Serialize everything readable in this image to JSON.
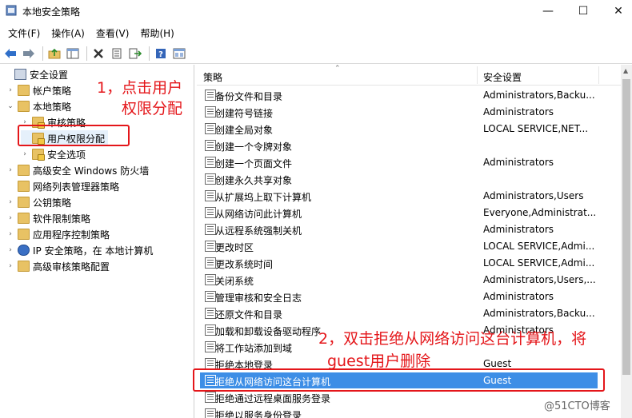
{
  "window": {
    "title": "本地安全策略",
    "minimize": "—",
    "maximize": "☐",
    "close": "✕"
  },
  "menu": [
    "文件(F)",
    "操作(A)",
    "查看(V)",
    "帮助(H)"
  ],
  "toolbar": [
    "back-arrow-icon",
    "forward-arrow-icon",
    "up-folder-icon",
    "show-tree-icon",
    "delete-icon",
    "properties-icon",
    "export-icon",
    "help-icon",
    "view-icon"
  ],
  "tree": [
    {
      "label": "安全设置",
      "twisty": "",
      "indent": 0
    },
    {
      "label": "帐户策略",
      "twisty": "›",
      "indent": 1
    },
    {
      "label": "本地策略",
      "twisty": "⌄",
      "indent": 1
    },
    {
      "label": "审核策略",
      "twisty": "›",
      "indent": 2
    },
    {
      "label": "用户权限分配",
      "twisty": "",
      "indent": 2
    },
    {
      "label": "安全选项",
      "twisty": "›",
      "indent": 2
    },
    {
      "label": "高级安全 Windows 防火墙",
      "twisty": "›",
      "indent": 1
    },
    {
      "label": "网络列表管理器策略",
      "twisty": "",
      "indent": 1
    },
    {
      "label": "公钥策略",
      "twisty": "›",
      "indent": 1
    },
    {
      "label": "软件限制策略",
      "twisty": "›",
      "indent": 1
    },
    {
      "label": "应用程序控制策略",
      "twisty": "›",
      "indent": 1
    },
    {
      "label": "IP 安全策略，在 本地计算机",
      "twisty": "›",
      "indent": 1
    },
    {
      "label": "高级审核策略配置",
      "twisty": "›",
      "indent": 1
    }
  ],
  "list": {
    "columns": [
      "策略",
      "安全设置"
    ],
    "rows": [
      {
        "policy": "备份文件和目录",
        "setting": "Administrators,Backu..."
      },
      {
        "policy": "创建符号链接",
        "setting": "Administrators"
      },
      {
        "policy": "创建全局对象",
        "setting": "LOCAL SERVICE,NET..."
      },
      {
        "policy": "创建一个令牌对象",
        "setting": ""
      },
      {
        "policy": "创建一个页面文件",
        "setting": "Administrators"
      },
      {
        "policy": "创建永久共享对象",
        "setting": ""
      },
      {
        "policy": "从扩展坞上取下计算机",
        "setting": "Administrators,Users"
      },
      {
        "policy": "从网络访问此计算机",
        "setting": "Everyone,Administrat..."
      },
      {
        "policy": "从远程系统强制关机",
        "setting": "Administrators"
      },
      {
        "policy": "更改时区",
        "setting": "LOCAL SERVICE,Admi..."
      },
      {
        "policy": "更改系统时间",
        "setting": "LOCAL SERVICE,Admi..."
      },
      {
        "policy": "关闭系统",
        "setting": "Administrators,Users,..."
      },
      {
        "policy": "管理审核和安全日志",
        "setting": "Administrators"
      },
      {
        "policy": "还原文件和目录",
        "setting": "Administrators,Backu..."
      },
      {
        "policy": "加载和卸载设备驱动程序",
        "setting": "Administrators"
      },
      {
        "policy": "将工作站添加到域",
        "setting": ""
      },
      {
        "policy": "拒绝本地登录",
        "setting": "Guest"
      },
      {
        "policy": "拒绝从网络访问这台计算机",
        "setting": "Guest"
      },
      {
        "policy": "拒绝通过远程桌面服务登录",
        "setting": ""
      },
      {
        "policy": "拒绝以服务身份登录",
        "setting": ""
      }
    ]
  },
  "annotations": {
    "step1_line1": "1，点击用户",
    "step1_line2": "权限分配",
    "step2_line1": "2，双击拒绝从网络访问这台计算机，将",
    "step2_line2": "guest用户删除"
  },
  "watermark": "@51CTO博客",
  "colors": {
    "selection": "#3d8ee6",
    "annotation": "#e4161a"
  }
}
